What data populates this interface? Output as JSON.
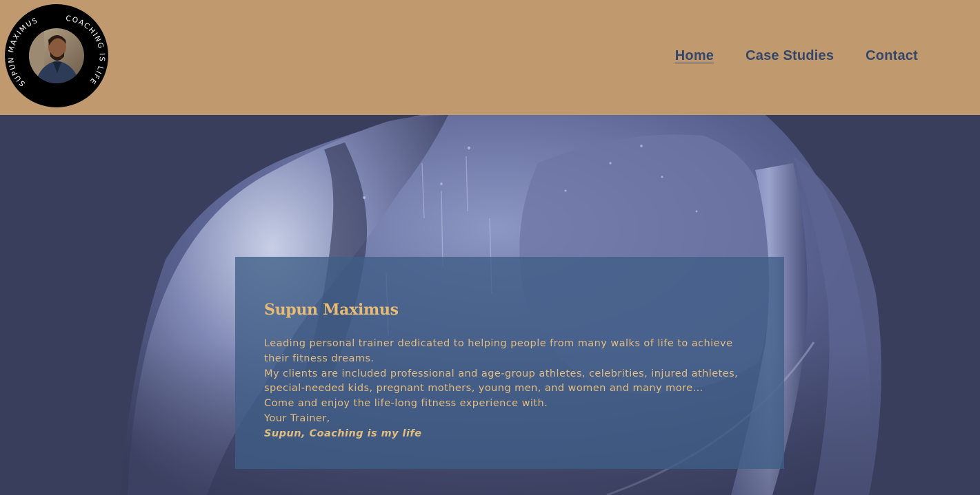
{
  "logo": {
    "ring_text_left": "SUPUN MAXIMUS",
    "ring_text_right": "COACHING IS LIFE",
    "background": "#000000",
    "ring_text_color": "#ffffff"
  },
  "nav": {
    "items": [
      {
        "label": "Home",
        "active": true
      },
      {
        "label": "Case Studies",
        "active": false
      },
      {
        "label": "Contact",
        "active": false
      }
    ]
  },
  "hero": {
    "title": "Supun Maximus",
    "lines": [
      "Leading personal trainer dedicated to helping people from many walks of life to achieve their fitness dreams.",
      "My clients are included professional and age-group athletes, celebrities, injured athletes, special-needed kids, pregnant mothers, young men, and women and many more...",
      "Come and enjoy the life-long fitness experience with.",
      "Your Trainer,"
    ],
    "signature": "Supun, Coaching is my life"
  },
  "colors": {
    "header_bg": "#c09a6e",
    "nav_text": "#34476a",
    "hero_bg": "#3a3e5d",
    "card_bg": "#3f5d87",
    "title_color": "#e7bb73",
    "body_text": "#e2bd80"
  }
}
